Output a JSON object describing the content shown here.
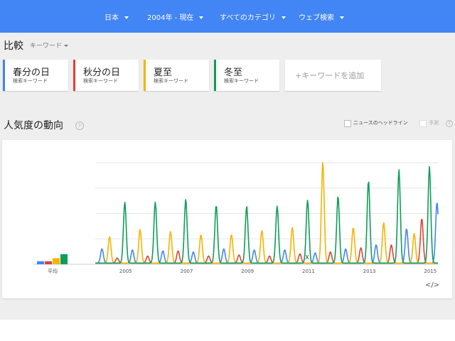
{
  "toolbar": {
    "region": "日本",
    "time_range": "2004年 - 現在",
    "category": "すべてのカテゴリ",
    "search_type": "ウェブ検索"
  },
  "compare": {
    "title": "比較",
    "mode": "キーワード",
    "keywords": [
      {
        "name": "春分の日",
        "sub": "検索キーワード",
        "color": "#4285f4"
      },
      {
        "name": "秋分の日",
        "sub": "検索キーワード",
        "color": "#db4437"
      },
      {
        "name": "夏至",
        "sub": "検索キーワード",
        "color": "#f4b400"
      },
      {
        "name": "冬至",
        "sub": "検索キーワード",
        "color": "#0f9d58"
      }
    ],
    "add_label": "+キーワードを追加"
  },
  "trend": {
    "title": "人気度の動向",
    "help": "?",
    "news_headlines_label": "ニュースのヘッドライン",
    "forecast_label": "予測",
    "embed_label": "</>"
  },
  "chart_data": {
    "type": "line",
    "x_tick_labels": [
      "2005",
      "2007",
      "2009",
      "2011",
      "2013",
      "2015"
    ],
    "x_range": [
      2004.0,
      2015.25
    ],
    "y_range": [
      0,
      100
    ],
    "grid": true,
    "average": {
      "label": "平均",
      "values": [
        3,
        3,
        6,
        10
      ]
    },
    "annotation": "X",
    "series": [
      {
        "name": "春分の日",
        "color": "#4285f4",
        "peaks": [
          [
            2004.22,
            14
          ],
          [
            2005.22,
            13
          ],
          [
            2006.22,
            12
          ],
          [
            2007.22,
            11
          ],
          [
            2008.22,
            14
          ],
          [
            2009.22,
            13
          ],
          [
            2010.22,
            13
          ],
          [
            2011.22,
            10
          ],
          [
            2012.22,
            14
          ],
          [
            2013.22,
            18
          ],
          [
            2014.22,
            34
          ],
          [
            2015.22,
            60
          ]
        ]
      },
      {
        "name": "秋分の日",
        "color": "#db4437",
        "peaks": [
          [
            2004.72,
            5
          ],
          [
            2005.72,
            7
          ],
          [
            2006.72,
            12
          ],
          [
            2007.72,
            7
          ],
          [
            2008.72,
            8
          ],
          [
            2009.72,
            7
          ],
          [
            2010.72,
            9
          ],
          [
            2011.72,
            11
          ],
          [
            2012.72,
            15
          ],
          [
            2013.72,
            18
          ],
          [
            2014.72,
            44
          ]
        ]
      },
      {
        "name": "夏至",
        "color": "#f4b400",
        "peaks": [
          [
            2004.47,
            26
          ],
          [
            2005.47,
            33
          ],
          [
            2006.47,
            31
          ],
          [
            2007.47,
            28
          ],
          [
            2008.47,
            28
          ],
          [
            2009.47,
            32
          ],
          [
            2010.47,
            35
          ],
          [
            2011.47,
            100
          ],
          [
            2012.47,
            35
          ],
          [
            2013.47,
            40
          ],
          [
            2014.47,
            29
          ]
        ]
      },
      {
        "name": "冬至",
        "color": "#0f9d58",
        "peaks": [
          [
            2004.97,
            60
          ],
          [
            2005.97,
            60
          ],
          [
            2006.97,
            63
          ],
          [
            2007.97,
            57
          ],
          [
            2008.97,
            56
          ],
          [
            2009.97,
            56
          ],
          [
            2010.97,
            62
          ],
          [
            2011.97,
            66
          ],
          [
            2012.97,
            81
          ],
          [
            2013.97,
            92
          ],
          [
            2014.97,
            95
          ]
        ]
      }
    ]
  }
}
